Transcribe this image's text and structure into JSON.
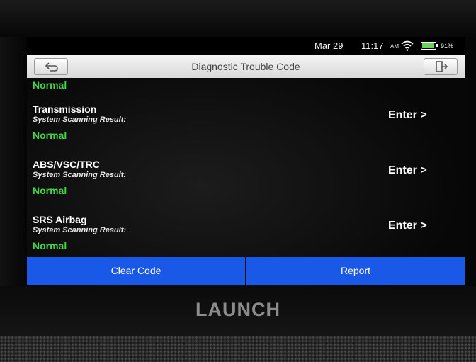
{
  "status_bar": {
    "date": "Mar 29",
    "time": "11:17",
    "ampm": "AM",
    "battery": "91%",
    "icons": [
      "wifi-icon",
      "battery-icon"
    ]
  },
  "title_bar": {
    "title": "Diagnostic Trouble Code",
    "back_icon": "back-arrow-icon",
    "exit_icon": "exit-icon"
  },
  "list": {
    "partial_status": "Normal",
    "items": [
      {
        "name": "Transmission",
        "subtitle": "System Scanning Result:",
        "status": "Normal",
        "action": "Enter >"
      },
      {
        "name": "ABS/VSC/TRC",
        "subtitle": "System Scanning Result:",
        "status": "Normal",
        "action": "Enter >"
      },
      {
        "name": "SRS Airbag",
        "subtitle": "System Scanning Result:",
        "status": "Normal",
        "action": "Enter >"
      }
    ]
  },
  "actions": {
    "clear_code": "Clear Code",
    "report": "Report"
  },
  "device": {
    "brand": "LAUNCH"
  },
  "colors": {
    "status_normal": "#41d645",
    "action_button": "#1a58e8",
    "title_bar": "#e6e6e6"
  }
}
